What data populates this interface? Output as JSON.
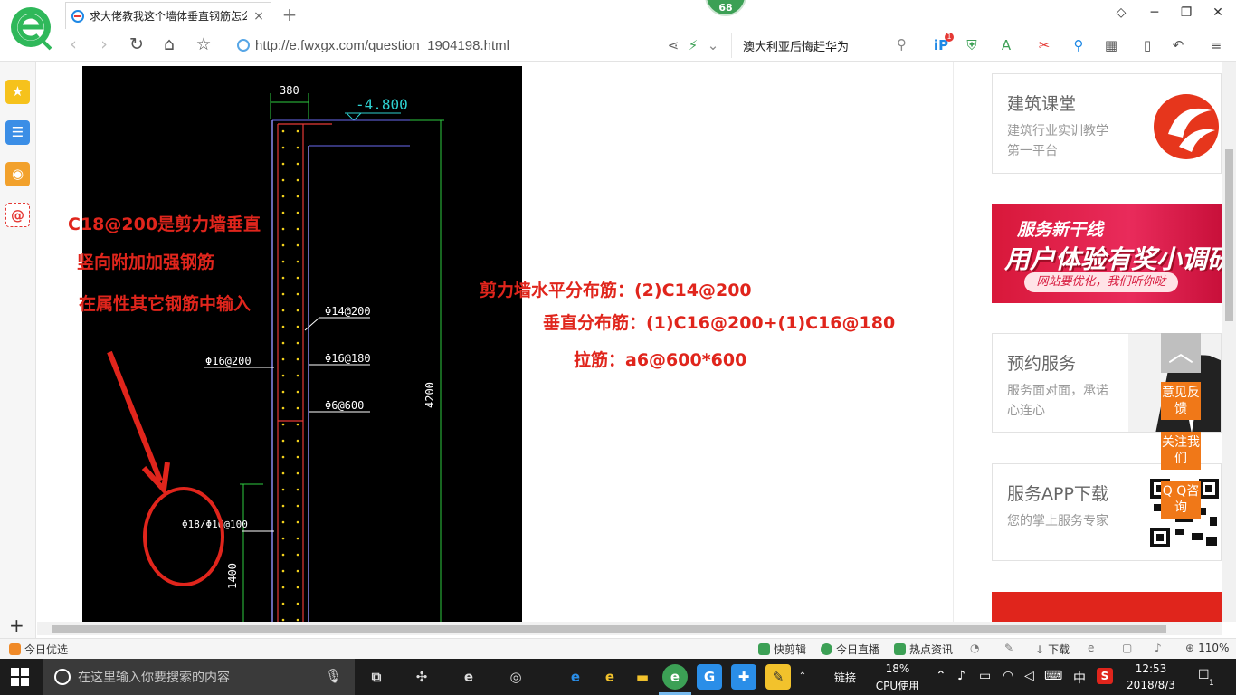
{
  "browser": {
    "tab_title": "求大佬教我这个墙体垂直钢筋怎么",
    "tab_close": "×",
    "new_tab": "+",
    "badge": "68",
    "url": "http://e.fwxgx.com/question_1904198.html",
    "search_text": "澳大利亚后悔赶华为",
    "notify_count": "1"
  },
  "cad": {
    "dim_top": "380",
    "elev": "-4.800",
    "lbl_d14": "Φ14@200",
    "lbl_d16_180": "Φ16@180",
    "lbl_d16_200": "Φ16@200",
    "lbl_d6": "Φ6@600",
    "lbl_circled": "Φ18/Φ16@100",
    "dim_height": "4200",
    "dim_low": "1400"
  },
  "annotations": {
    "left_line1": "C18@200是剪力墙垂直",
    "left_line2": "竖向附加加强钢筋",
    "left_line3": "在属性其它钢筋中输入",
    "right_line1": "剪力墙水平分布筋：(2)C14@200",
    "right_line2": "垂直分布筋：(1)C16@200+(1)C16@180",
    "right_line3": "拉筋：a6@600*600"
  },
  "sidebar_cards": [
    {
      "title": "建筑课堂",
      "desc": "建筑行业实训教学第一平台"
    },
    {
      "title": "预约服务",
      "desc": "服务面对面，承诺心连心"
    },
    {
      "title": "服务APP下载",
      "desc": "您的掌上服务专家"
    }
  ],
  "banner": {
    "line1": "服务新干线",
    "line2": "用户体验有奖小调研",
    "line3": "网站要优化，我们听你哒"
  },
  "float_buttons": {
    "feedback": "意见反馈",
    "follow": "关注我们",
    "qq": "Q Q咨询"
  },
  "statusbar": {
    "left": "今日优选",
    "kuaijianji": "快剪辑",
    "live": "今日直播",
    "news": "热点资讯",
    "download": "下载",
    "zoom": "110%"
  },
  "taskbar": {
    "search_placeholder": "在这里输入你要搜索的内容",
    "link": "链接",
    "cpu_pct": "18%",
    "cpu_label": "CPU使用",
    "ime": "中",
    "time": "12:53",
    "date": "2018/8/3",
    "notif": "1"
  },
  "colors": {
    "annotation_red": "#e0251c",
    "float_orange": "#f07818",
    "browser_green": "#3ca055"
  }
}
